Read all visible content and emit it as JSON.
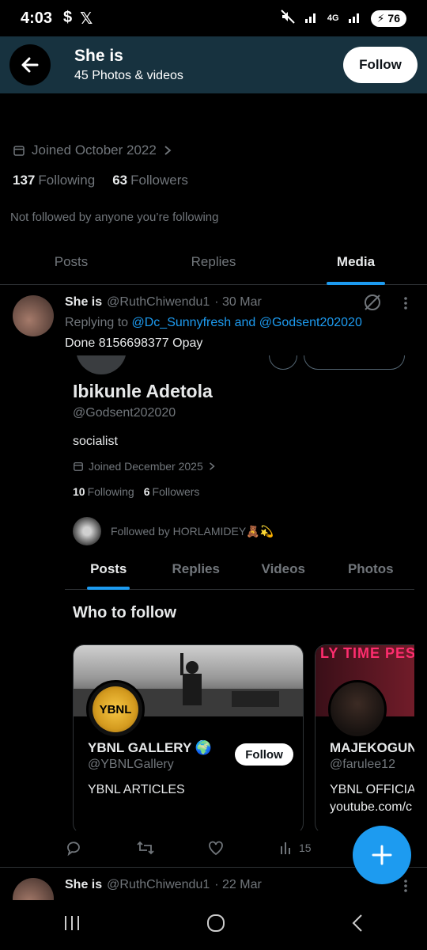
{
  "status_bar": {
    "time": "4:03",
    "left_icons": [
      "dollar-icon",
      "x-logo-icon"
    ],
    "network": "4G",
    "battery": "76"
  },
  "header": {
    "title": "She is",
    "subtitle": "45 Photos & videos",
    "follow_label": "Follow"
  },
  "profile": {
    "handle_peek": "@RuthChiwendu1",
    "joined": "Joined October 2022",
    "following_count": "137",
    "following_label": "Following",
    "followers_count": "63",
    "followers_label": "Followers",
    "not_followed": "Not followed by anyone you’re following"
  },
  "tabs": [
    {
      "label": "Posts",
      "active": false
    },
    {
      "label": "Replies",
      "active": false
    },
    {
      "label": "Media",
      "active": true
    }
  ],
  "post": {
    "name": "She is",
    "handle": "@RuthChiwendu1",
    "date": "· 30 Mar",
    "replying_prefix": "Replying to",
    "replying_to": "@Dc_Sunnyfresh and @Godsent202020",
    "text": "Done 8156698377 Opay",
    "embed": {
      "name": "Ibikunle Adetola",
      "handle": "@Godsent202020",
      "bio": "socialist",
      "joined": "Joined December 2025",
      "following_count": "10",
      "following_label": "Following",
      "followers_count": "6",
      "followers_label": "Followers",
      "followed_by": "Followed by HORLAMIDEY🧸💫",
      "tabs": [
        {
          "label": "Posts",
          "active": true
        },
        {
          "label": "Replies",
          "active": false
        },
        {
          "label": "Videos",
          "active": false
        },
        {
          "label": "Photos",
          "active": false
        }
      ],
      "who_to_follow": "Who to follow",
      "cards": [
        {
          "name": "YBNL GALLERY 🌍",
          "handle": "@YBNLGallery",
          "bio": "YBNL ARTICLES",
          "follow_label": "Follow",
          "logo_text": "YBNL"
        },
        {
          "name": "MAJEKOGUNS",
          "handle": "@farulee12",
          "bio": "YBNL OFFICIA",
          "bio2": "youtube.com/c",
          "banner_text": "LY TIME PES"
        }
      ]
    },
    "stats": {
      "replies": "",
      "reposts": "",
      "likes": "",
      "views": "15"
    }
  },
  "post2": {
    "name": "She is",
    "handle": "@RuthChiwendu1",
    "date": "· 22 Mar"
  },
  "colors": {
    "accent": "#1d9bf0",
    "header_bg": "#17323f",
    "muted": "#71767b"
  }
}
